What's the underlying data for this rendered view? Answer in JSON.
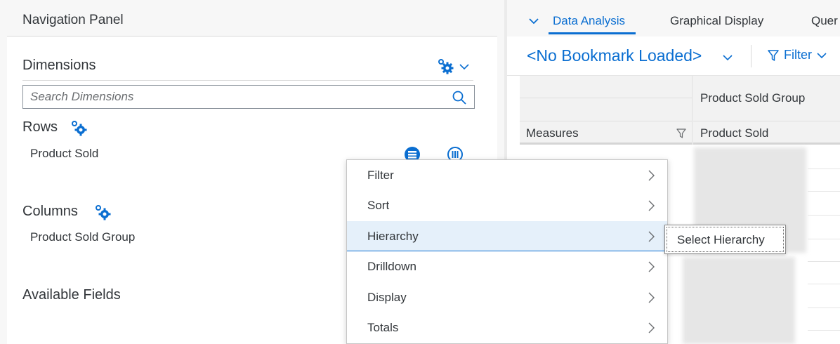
{
  "nav_panel": {
    "title": "Navigation Panel",
    "dimensions": {
      "title": "Dimensions",
      "search_placeholder": "Search Dimensions"
    },
    "rows": {
      "title": "Rows",
      "items": [
        {
          "label": "Product Sold"
        }
      ]
    },
    "columns": {
      "title": "Columns",
      "items": [
        {
          "label": "Product Sold Group"
        }
      ]
    },
    "available_fields": {
      "title": "Available Fields"
    }
  },
  "tabs": [
    {
      "label": "Data Analysis",
      "active": true
    },
    {
      "label": "Graphical Display",
      "active": false
    },
    {
      "label": "Quer",
      "active": false
    }
  ],
  "bookmark": {
    "title": "<No Bookmark Loaded>",
    "filter_label": "Filter"
  },
  "grid": {
    "col_header_top": "Product Sold Group",
    "measures_header": "Measures",
    "col_header_bottom": "Product Sold"
  },
  "context_menu": {
    "items": [
      {
        "label": "Filter"
      },
      {
        "label": "Sort"
      },
      {
        "label": "Hierarchy"
      },
      {
        "label": "Drilldown"
      },
      {
        "label": "Display"
      },
      {
        "label": "Totals"
      }
    ],
    "active_index": 2,
    "submenu": {
      "items": [
        {
          "label": "Select Hierarchy"
        }
      ]
    }
  },
  "colors": {
    "accent": "#0a6ed1",
    "text": "#32363a",
    "hover": "#e5f0fa"
  },
  "icons": [
    "settings-icon",
    "chevron-down-icon",
    "search-icon",
    "hierarchy-icon",
    "columns-icon",
    "filter-icon",
    "chevron-right-icon"
  ]
}
